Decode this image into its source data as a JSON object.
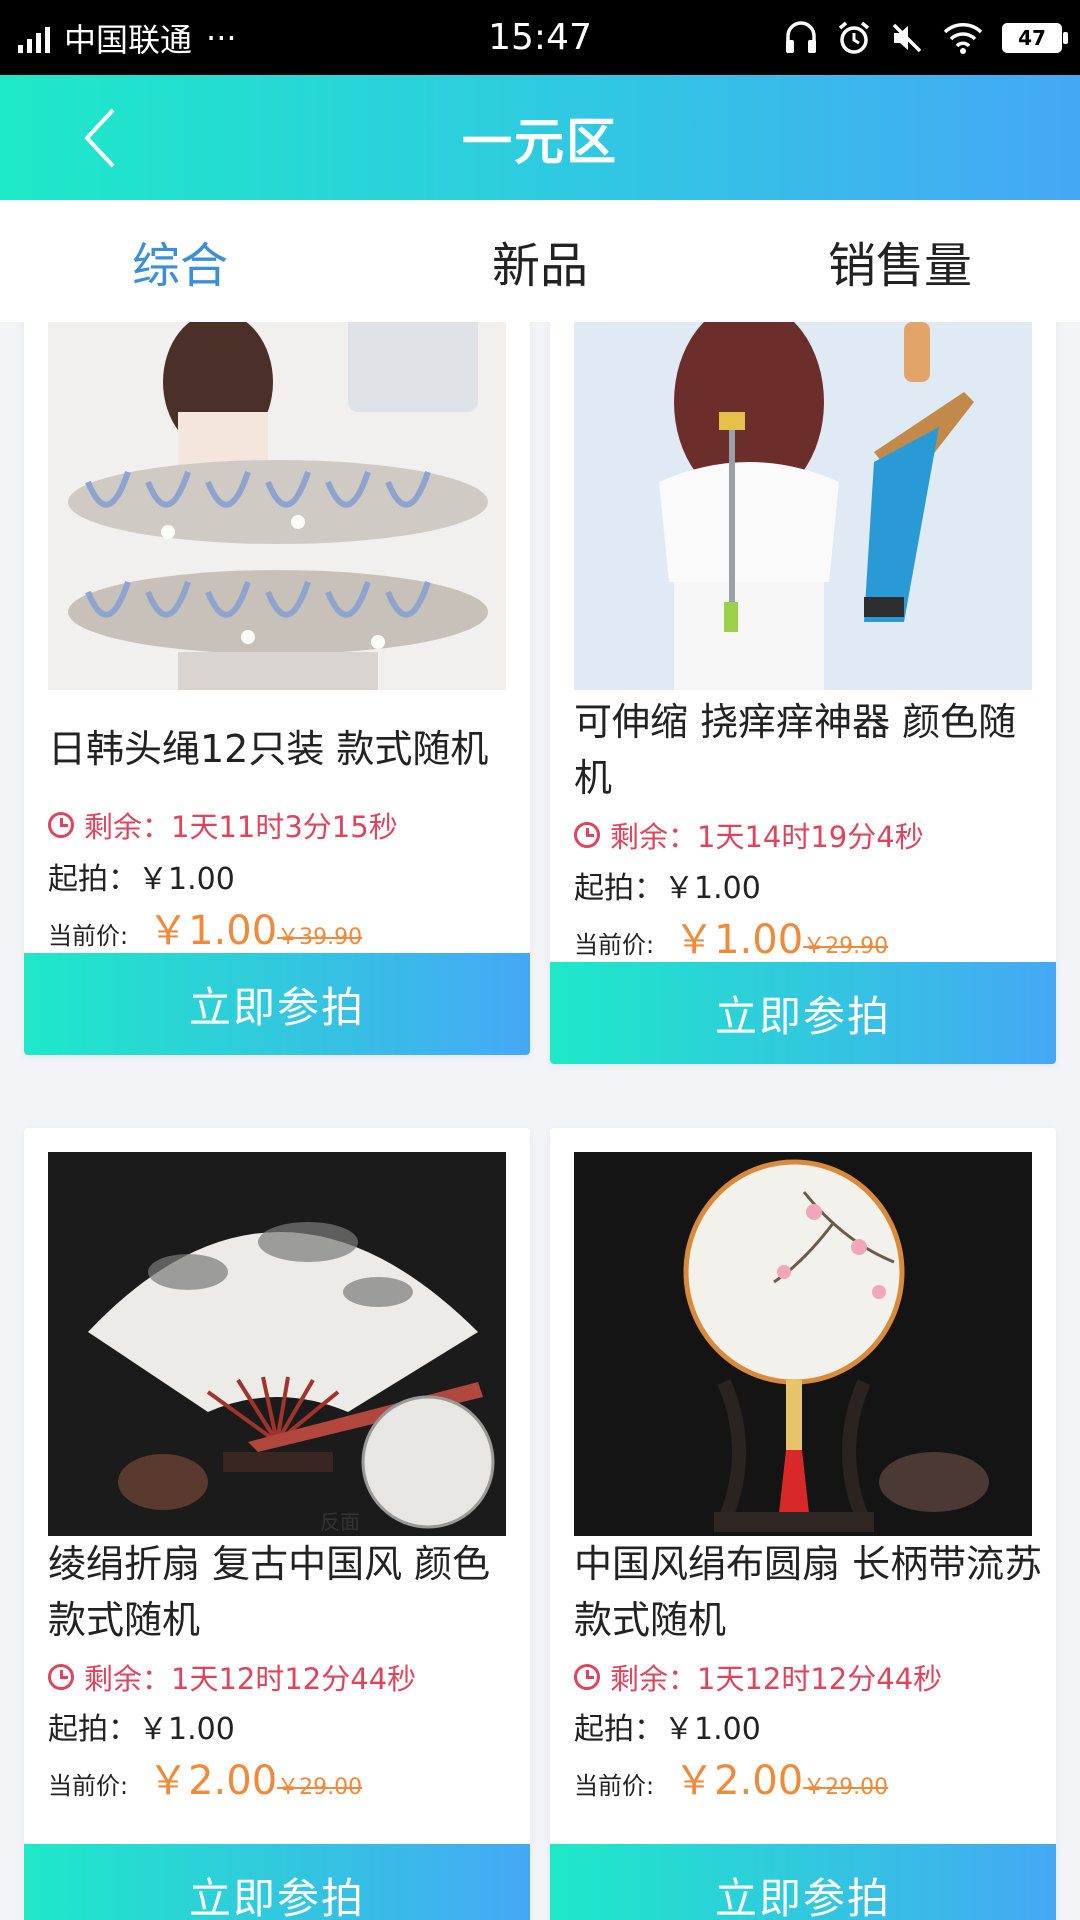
{
  "status_bar": {
    "network": "4G",
    "carrier": "中国联通",
    "more": "···",
    "time": "15:47",
    "battery": "47"
  },
  "header": {
    "title": "一元区"
  },
  "tabs": [
    {
      "label": "综合",
      "active": true
    },
    {
      "label": "新品",
      "active": false
    },
    {
      "label": "销售量",
      "active": false
    }
  ],
  "products": [
    {
      "title": "日韩头绳12只装 款式随机",
      "remaining": "剩余：1天11时3分15秒",
      "start_price": "起拍：￥1.00",
      "current_label": "当前价:",
      "current_price": "￥1.00",
      "original_price": "￥39.90",
      "button": "立即参拍",
      "image_icon": "hair-ties-image"
    },
    {
      "title": "可伸缩 挠痒痒神器 颜色随机",
      "remaining": "剩余：1天14时19分4秒",
      "start_price": "起拍：￥1.00",
      "current_label": "当前价:",
      "current_price": "￥1.00",
      "original_price": "￥29.90",
      "button": "立即参拍",
      "image_icon": "back-scratcher-image"
    },
    {
      "title": "绫绢折扇 复古中国风 颜色款式随机",
      "remaining": "剩余：1天12时12分44秒",
      "start_price": "起拍：￥1.00",
      "current_label": "当前价:",
      "current_price": "￥2.00",
      "original_price": "￥29.00",
      "button": "立即参拍",
      "image_icon": "folding-fan-image",
      "image_caption": "反面"
    },
    {
      "title": "中国风绢布圆扇 长柄带流苏 款式随机",
      "remaining": "剩余：1天12时12分44秒",
      "start_price": "起拍：￥1.00",
      "current_label": "当前价:",
      "current_price": "￥2.00",
      "original_price": "￥29.00",
      "button": "立即参拍",
      "image_icon": "round-fan-image"
    }
  ],
  "colors": {
    "accent_start": "#1de9c7",
    "accent_end": "#45a8f5",
    "active_tab": "#3b8fd7",
    "countdown": "#e0445d",
    "price": "#ef8a3b"
  }
}
